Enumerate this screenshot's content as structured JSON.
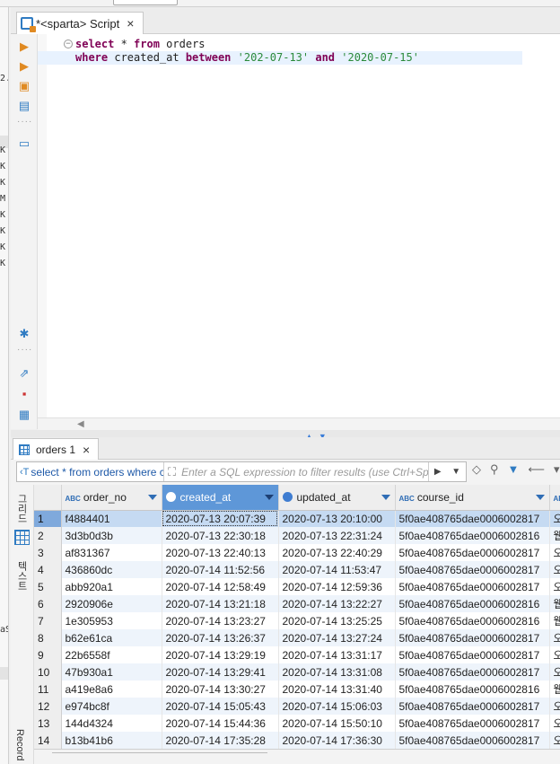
{
  "left_sliver": {
    "glyphs": [
      {
        "text": "2./",
        "row": 1
      },
      {
        "text": "K",
        "row": 2
      },
      {
        "text": "K",
        "row": 3
      },
      {
        "text": "K",
        "row": 4
      },
      {
        "text": "M",
        "row": 5
      },
      {
        "text": "K",
        "row": 6
      },
      {
        "text": "K",
        "row": 7
      },
      {
        "text": "K",
        "row": 8
      },
      {
        "text": "K",
        "row": 9
      },
      {
        "text": "aS",
        "row": 10
      }
    ]
  },
  "editor_tab": {
    "title": "*<sparta> Script",
    "close": "×"
  },
  "editor": {
    "line1": {
      "kw_select": "select",
      "star": " * ",
      "kw_from": "from",
      "table": " orders"
    },
    "line2": {
      "kw_where": "where",
      "col": " created_at ",
      "kw_between": "between",
      "sp1": " ",
      "v1": "'202-07-13'",
      "sp2": " ",
      "kw_and": "and",
      "sp3": " ",
      "v2": "'2020-07-15'"
    }
  },
  "results_tab": {
    "title": "orders 1",
    "close": "×"
  },
  "filter": {
    "query_text": "select * from orders where created_at between",
    "placeholder": "Enter a SQL expression to filter results (use Ctrl+Space)"
  },
  "side_labels": {
    "grid": "그리드",
    "text": "텍스트",
    "record": "Record"
  },
  "grid": {
    "columns": [
      {
        "label": "order_no",
        "type": "ABC"
      },
      {
        "label": "created_at",
        "type": "clock"
      },
      {
        "label": "updated_at",
        "type": "clock"
      },
      {
        "label": "course_id",
        "type": "ABC"
      },
      {
        "label": "",
        "type": "ABC"
      }
    ],
    "rows": [
      {
        "n": "1",
        "order_no": "f4884401",
        "created_at": "2020-07-13 20:07:39",
        "updated_at": "2020-07-13 20:10:00",
        "course_id": "5f0ae408765dae0006002817",
        "extra": "오"
      },
      {
        "n": "2",
        "order_no": "3d3b0d3b",
        "created_at": "2020-07-13 22:30:18",
        "updated_at": "2020-07-13 22:31:24",
        "course_id": "5f0ae408765dae0006002816",
        "extra": "웹"
      },
      {
        "n": "3",
        "order_no": "af831367",
        "created_at": "2020-07-13 22:40:13",
        "updated_at": "2020-07-13 22:40:29",
        "course_id": "5f0ae408765dae0006002817",
        "extra": "오"
      },
      {
        "n": "4",
        "order_no": "436860dc",
        "created_at": "2020-07-14 11:52:56",
        "updated_at": "2020-07-14 11:53:47",
        "course_id": "5f0ae408765dae0006002817",
        "extra": "오"
      },
      {
        "n": "5",
        "order_no": "abb920a1",
        "created_at": "2020-07-14 12:58:49",
        "updated_at": "2020-07-14 12:59:36",
        "course_id": "5f0ae408765dae0006002817",
        "extra": "오"
      },
      {
        "n": "6",
        "order_no": "2920906e",
        "created_at": "2020-07-14 13:21:18",
        "updated_at": "2020-07-14 13:22:27",
        "course_id": "5f0ae408765dae0006002816",
        "extra": "웹"
      },
      {
        "n": "7",
        "order_no": "1e305953",
        "created_at": "2020-07-14 13:23:27",
        "updated_at": "2020-07-14 13:25:25",
        "course_id": "5f0ae408765dae0006002816",
        "extra": "웹"
      },
      {
        "n": "8",
        "order_no": "b62e61ca",
        "created_at": "2020-07-14 13:26:37",
        "updated_at": "2020-07-14 13:27:24",
        "course_id": "5f0ae408765dae0006002817",
        "extra": "오"
      },
      {
        "n": "9",
        "order_no": "22b6558f",
        "created_at": "2020-07-14 13:29:19",
        "updated_at": "2020-07-14 13:31:17",
        "course_id": "5f0ae408765dae0006002817",
        "extra": "오"
      },
      {
        "n": "10",
        "order_no": "47b930a1",
        "created_at": "2020-07-14 13:29:41",
        "updated_at": "2020-07-14 13:31:08",
        "course_id": "5f0ae408765dae0006002817",
        "extra": "오"
      },
      {
        "n": "11",
        "order_no": "a419e8a6",
        "created_at": "2020-07-14 13:30:27",
        "updated_at": "2020-07-14 13:31:40",
        "course_id": "5f0ae408765dae0006002816",
        "extra": "웹"
      },
      {
        "n": "12",
        "order_no": "e974bc8f",
        "created_at": "2020-07-14 15:05:43",
        "updated_at": "2020-07-14 15:06:03",
        "course_id": "5f0ae408765dae0006002817",
        "extra": "오"
      },
      {
        "n": "13",
        "order_no": "144d4324",
        "created_at": "2020-07-14 15:44:36",
        "updated_at": "2020-07-14 15:50:10",
        "course_id": "5f0ae408765dae0006002817",
        "extra": "오"
      },
      {
        "n": "14",
        "order_no": "b13b41b6",
        "created_at": "2020-07-14 17:35:28",
        "updated_at": "2020-07-14 17:36:30",
        "course_id": "5f0ae408765dae0006002817",
        "extra": "오"
      }
    ]
  }
}
